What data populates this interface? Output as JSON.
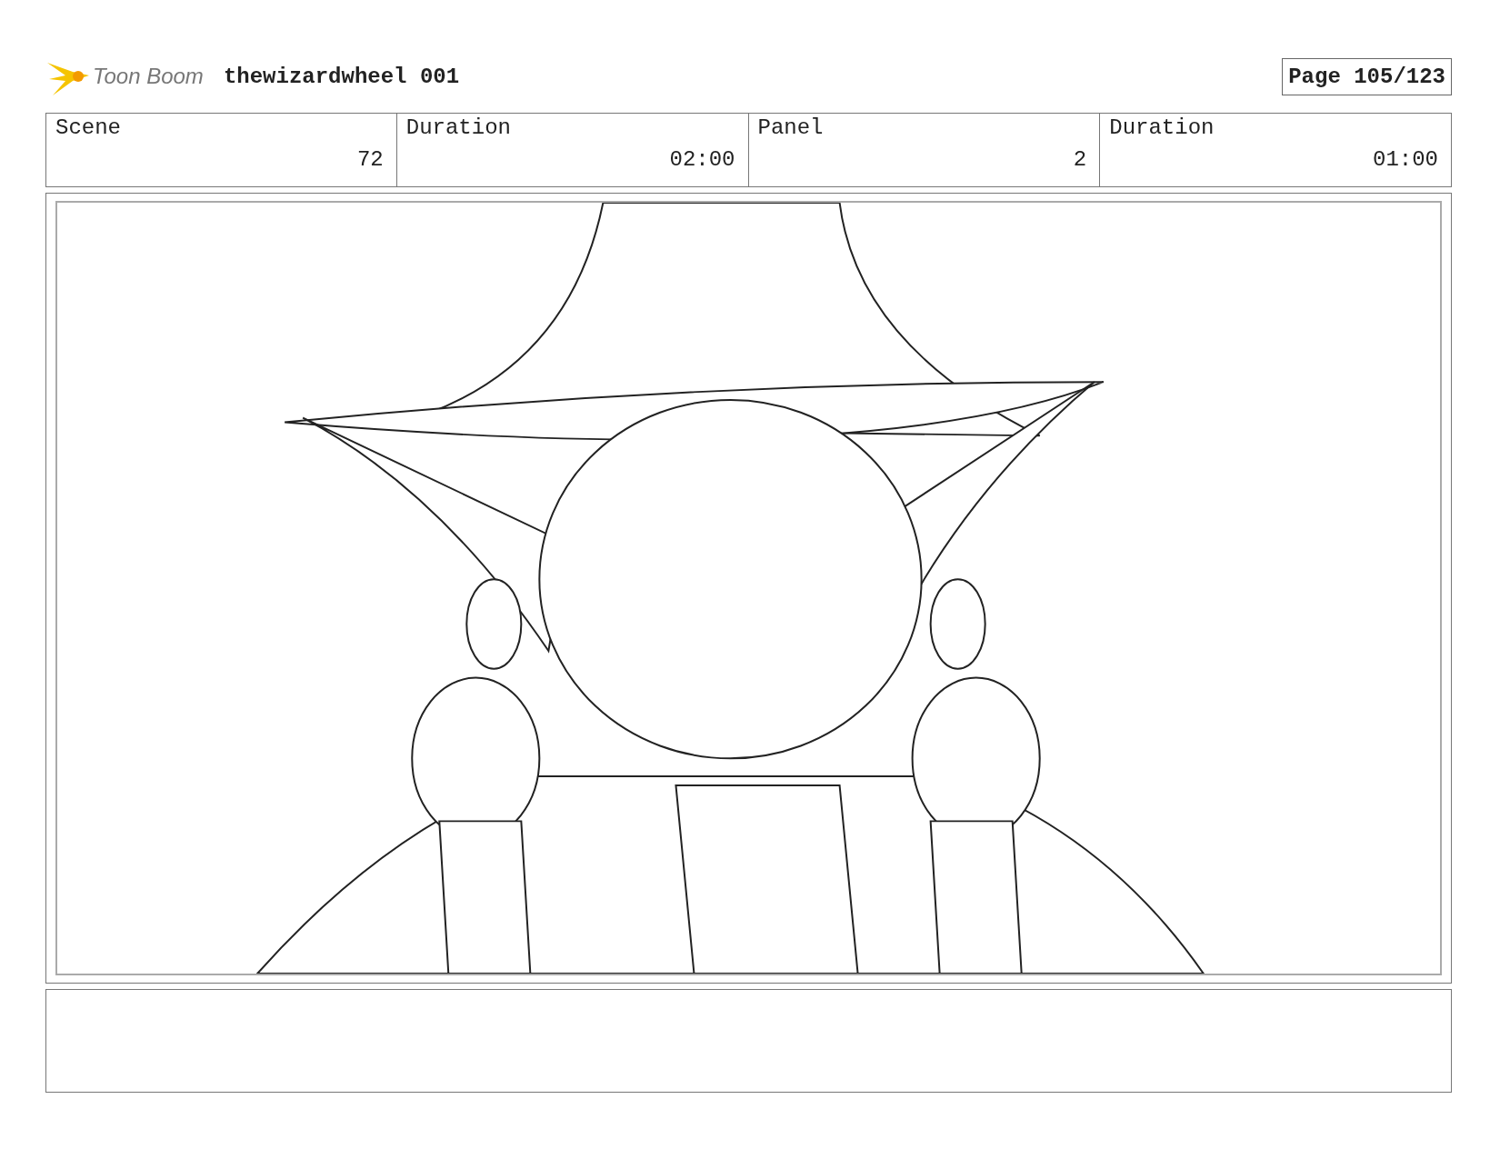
{
  "header": {
    "logo_text": "Toon Boom",
    "project": "thewizardwheel 001",
    "page": "Page 105/123"
  },
  "fields": [
    {
      "label": "Scene",
      "value": "72"
    },
    {
      "label": "Duration",
      "value": "02:00"
    },
    {
      "label": "Panel",
      "value": "2"
    },
    {
      "label": "Duration",
      "value": "01:00"
    }
  ]
}
